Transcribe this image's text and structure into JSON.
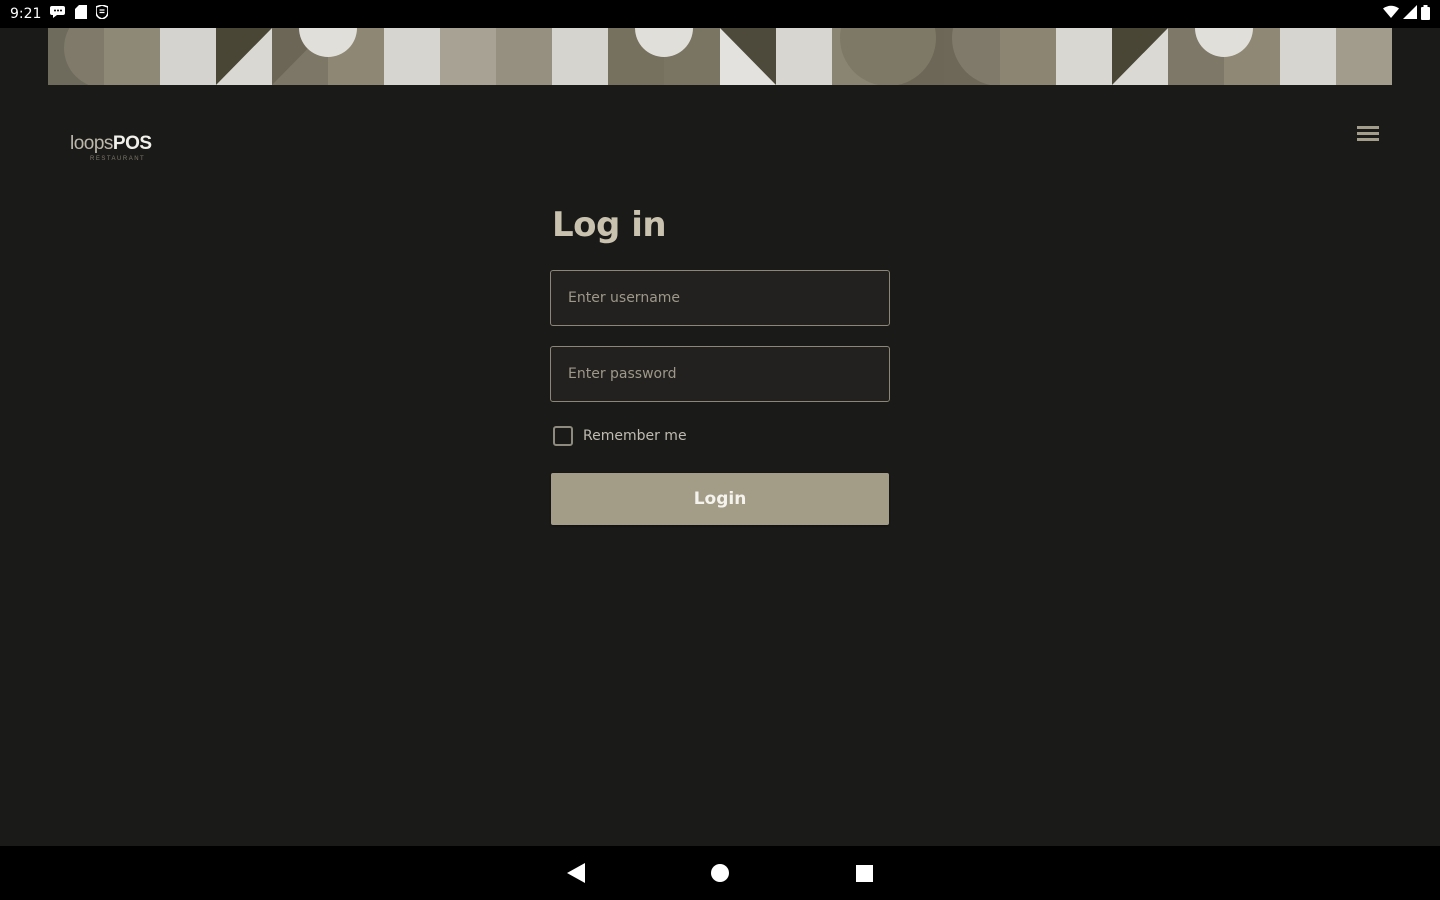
{
  "status_bar": {
    "time": "9:21",
    "left_icons": [
      "chat-icon",
      "sd-card-icon",
      "shield-icon"
    ],
    "right_icons": [
      "wifi-icon",
      "signal-icon",
      "battery-icon"
    ]
  },
  "banner": {
    "description_icon": "geometric-pattern-banner"
  },
  "header": {
    "logo_loops": "loops",
    "logo_pos": "POS",
    "logo_sub": "RESTAURANT",
    "menu_icon": "hamburger-menu-icon"
  },
  "login": {
    "title": "Log in",
    "username_placeholder": "Enter username",
    "username_value": "",
    "password_placeholder": "Enter password",
    "password_value": "",
    "remember_label": "Remember me",
    "remember_checked": false,
    "button_label": "Login"
  },
  "nav_bar": {
    "back_icon": "back-triangle-icon",
    "home_icon": "home-circle-icon",
    "recents_icon": "recents-square-icon"
  },
  "colors": {
    "background": "#1a1a19",
    "accent": "#a39c87",
    "title": "#c9c2af",
    "field_border": "#8b8678"
  }
}
